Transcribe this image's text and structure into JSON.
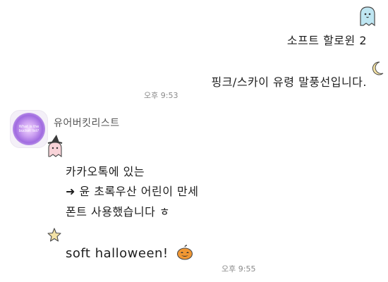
{
  "chat": {
    "outgoing": {
      "lines": [
        "소프트 할로윈 2",
        "핑크/스카이 유령 말풍선입니다."
      ],
      "time": "오후 9:53"
    },
    "incoming": {
      "sender": "유어버킷리스트",
      "avatar_text": "What is the bucket list?",
      "lines": [
        "카카오톡에 있는",
        "➜ 윤 초록우산 어린이 만세",
        "폰트 사용했습니다 ㅎ"
      ],
      "english_line": "soft halloween!",
      "time": "오후 9:55"
    }
  },
  "colors": {
    "ghost_sky": "#bfe6f2",
    "ghost_pink": "#f8d3d8",
    "moon": "#f5e3a3",
    "star": "#f3e2a6",
    "pumpkin": "#f19733",
    "avatar_purple": "#c99cf0"
  },
  "icons": [
    "ghost-sky-icon",
    "moon-icon",
    "ghost-pink-witch-icon",
    "star-icon",
    "pumpkin-icon"
  ]
}
